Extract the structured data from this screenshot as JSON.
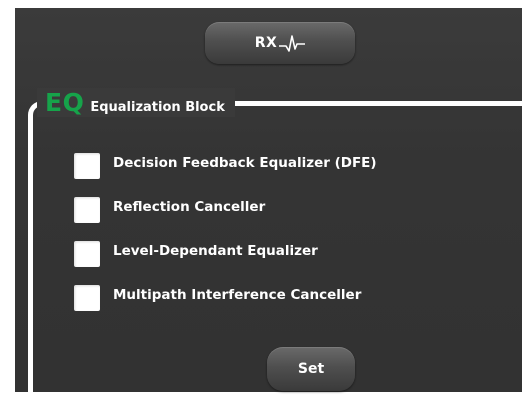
{
  "header": {
    "rx_button_label": "RX",
    "rx_icon": "pulse-icon"
  },
  "equalization": {
    "logo_text": "EQ",
    "logo_color": "#16a34a",
    "title": "Equalization Block",
    "options": [
      {
        "label": "Decision Feedback Equalizer (DFE)",
        "checked": false
      },
      {
        "label": "Reflection Canceller",
        "checked": false
      },
      {
        "label": "Level-Dependant Equalizer",
        "checked": false
      },
      {
        "label": "Multipath Interference Canceller",
        "checked": false
      }
    ],
    "set_button_label": "Set"
  },
  "colors": {
    "panel_background": "#363636",
    "frame_line": "#ffffff",
    "text": "#ffffff"
  }
}
